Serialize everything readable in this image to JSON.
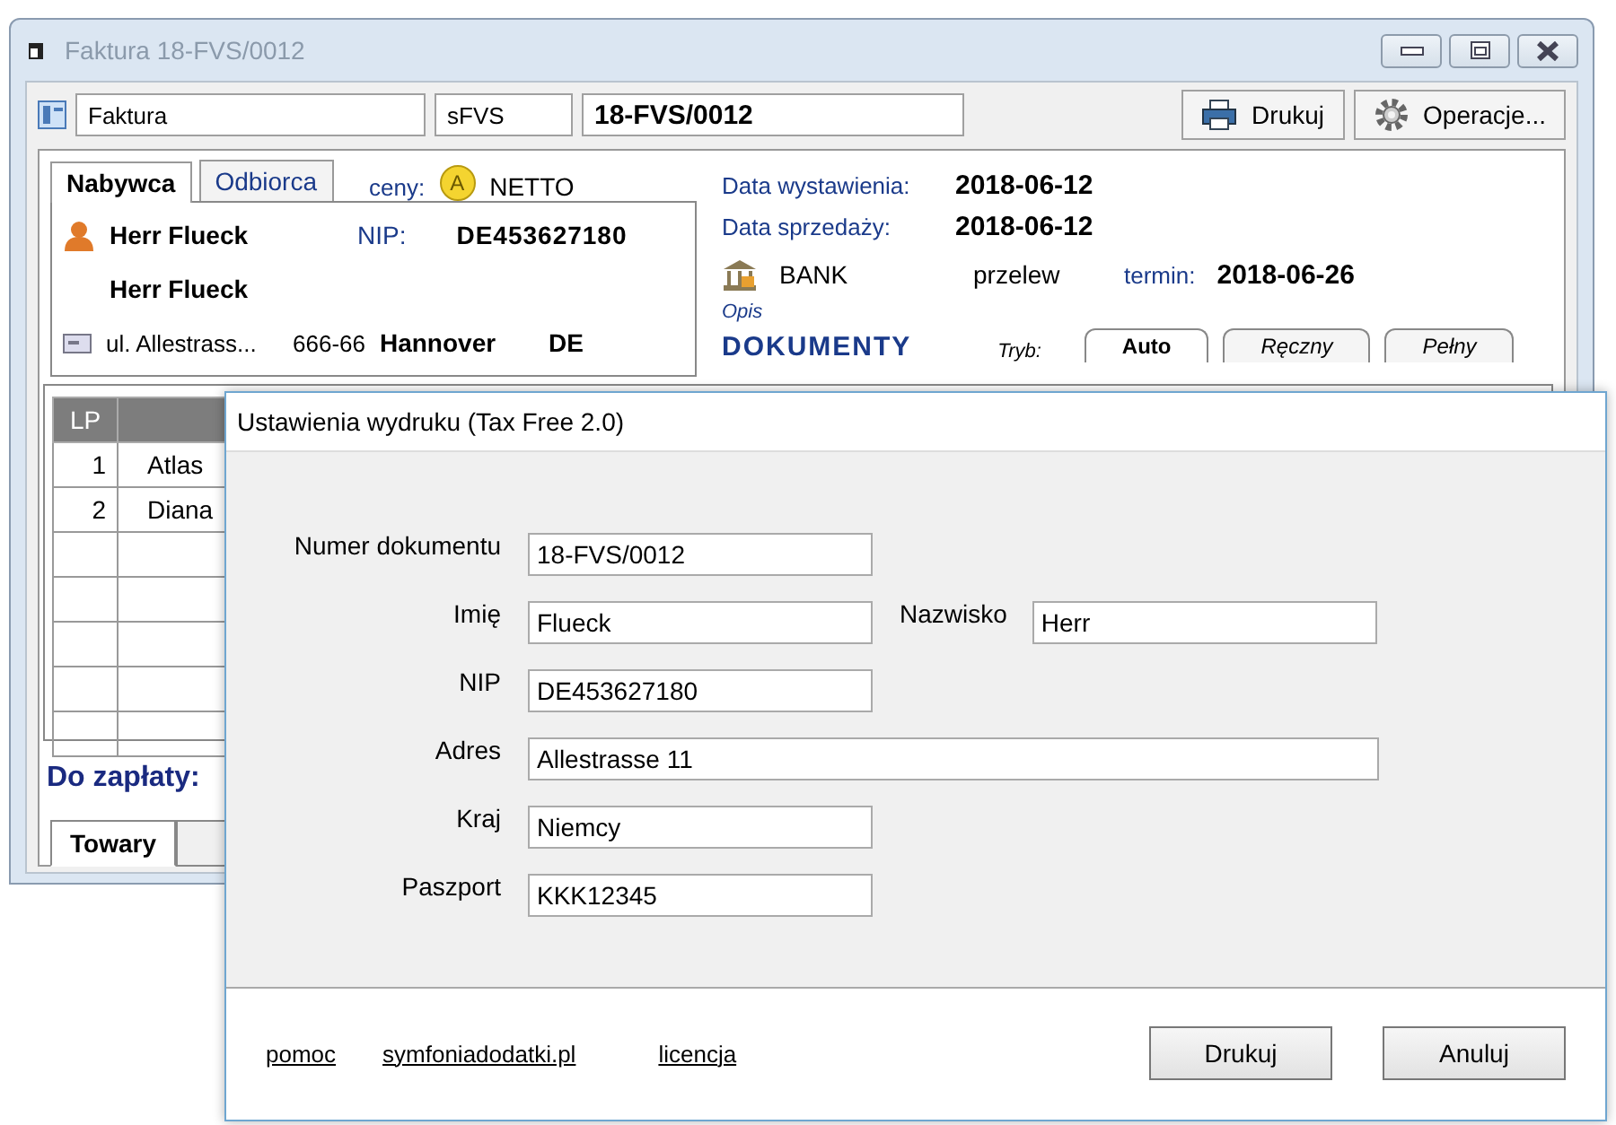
{
  "window": {
    "title": "Faktura 18-FVS/0012"
  },
  "header": {
    "doc_type": "Faktura",
    "series": "sFVS",
    "number": "18-FVS/0012",
    "buttons": [
      {
        "label": "Drukuj",
        "kind": "print"
      },
      {
        "label": "Operacje...",
        "kind": "gear"
      }
    ]
  },
  "party_tabs": [
    {
      "label": "Nabywca",
      "selected": true
    },
    {
      "label": "Odbiorca",
      "selected": false
    }
  ],
  "prices": {
    "label": "ceny:",
    "badge": "A",
    "mode": "NETTO"
  },
  "buyer": {
    "name": "Herr Flueck",
    "nip_label": "NIP:",
    "nip": "DE453627180",
    "full_name": "Herr Flueck",
    "street": "ul. Allestrass...",
    "postcode": "666-66",
    "city": "Hannover",
    "country": "DE"
  },
  "dates": [
    {
      "label": "Data wystawienia:",
      "value": "2018-06-12"
    },
    {
      "label": "Data sprzedaży:",
      "value": "2018-06-12"
    }
  ],
  "payment": {
    "method": "BANK",
    "type": "przelew",
    "term_label": "termin:",
    "term": "2018-06-26"
  },
  "description_label": "Opis",
  "documents": {
    "title": "DOKUMENTY",
    "mode_label": "Tryb:",
    "modes": [
      {
        "label": "Auto",
        "selected": true
      },
      {
        "label": "Ręczny",
        "selected": false
      },
      {
        "label": "Pełny",
        "selected": false
      }
    ]
  },
  "table": {
    "columns": [
      "LP"
    ],
    "rows": [
      [
        "1",
        "Atlas"
      ],
      [
        "2",
        "Diana"
      ],
      [
        "",
        ""
      ],
      [
        "",
        ""
      ],
      [
        "",
        ""
      ],
      [
        "",
        ""
      ],
      [
        "",
        ""
      ]
    ]
  },
  "total_label": "Do zapłaty:",
  "bottom_tabs": [
    {
      "label": "Towary",
      "selected": true
    },
    {
      "selected": false
    }
  ],
  "dialog": {
    "title": "Ustawienia wydruku (Tax Free 2.0)",
    "fields": [
      {
        "label": "Numer dokumentu",
        "value": "18-FVS/0012",
        "wide": false
      },
      {
        "label": "Imię",
        "value": "Flueck",
        "wide": false,
        "extra": {
          "label": "Nazwisko",
          "value": "Herr"
        }
      },
      {
        "label": "NIP",
        "value": "DE453627180",
        "wide": false
      },
      {
        "label": "Adres",
        "value": "Allestrasse 11",
        "wide": true
      },
      {
        "label": "Kraj",
        "value": "Niemcy",
        "wide": false
      },
      {
        "label": "Paszport",
        "value": "KKK12345",
        "wide": false
      }
    ],
    "links": [
      "pomoc",
      "symfoniadodatki.pl",
      "licencja"
    ],
    "buttons": [
      "Drukuj",
      "Anuluj"
    ]
  }
}
